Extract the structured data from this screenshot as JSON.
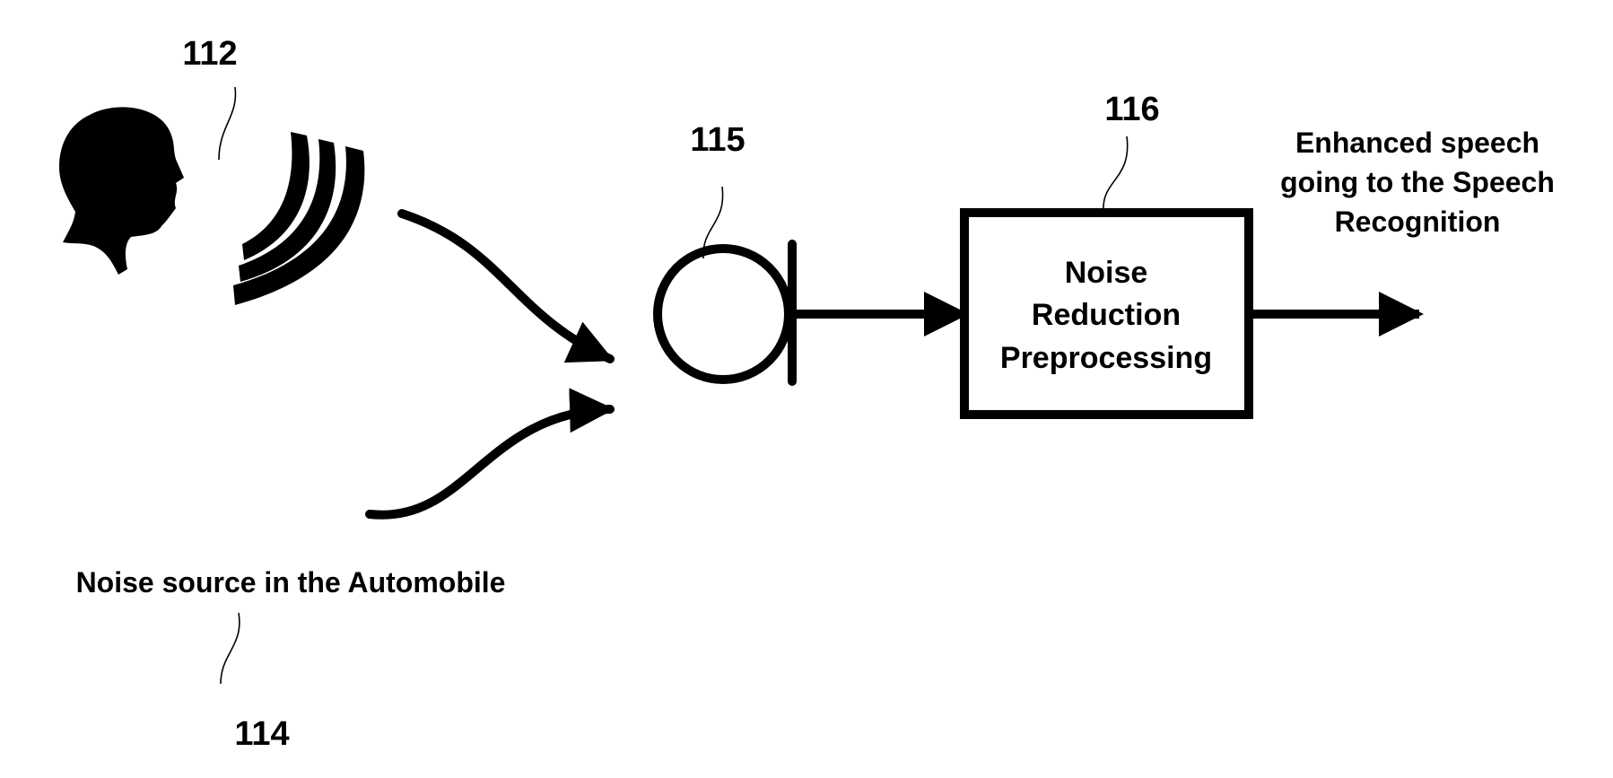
{
  "diagram": {
    "type": "block-diagram",
    "colors": {
      "ink": "#000000",
      "background": "#ffffff"
    },
    "speaker": {
      "ref": "112",
      "icon": "speaker-head-silhouette",
      "waves_icon": "sound-waves"
    },
    "noise_source": {
      "label": "Noise source in the Automobile",
      "ref": "114"
    },
    "microphone": {
      "ref": "115",
      "icon": "microphone-symbol"
    },
    "processing_block": {
      "ref": "116",
      "lines": [
        "Noise",
        "Reduction",
        "Preprocessing"
      ]
    },
    "output": {
      "lines": [
        "Enhanced speech",
        "going to the Speech",
        "Recognition"
      ]
    },
    "edges": [
      {
        "from": "speaker",
        "to": "microphone"
      },
      {
        "from": "noise_source",
        "to": "microphone"
      },
      {
        "from": "microphone",
        "to": "processing_block"
      },
      {
        "from": "processing_block",
        "to": "output"
      }
    ]
  }
}
